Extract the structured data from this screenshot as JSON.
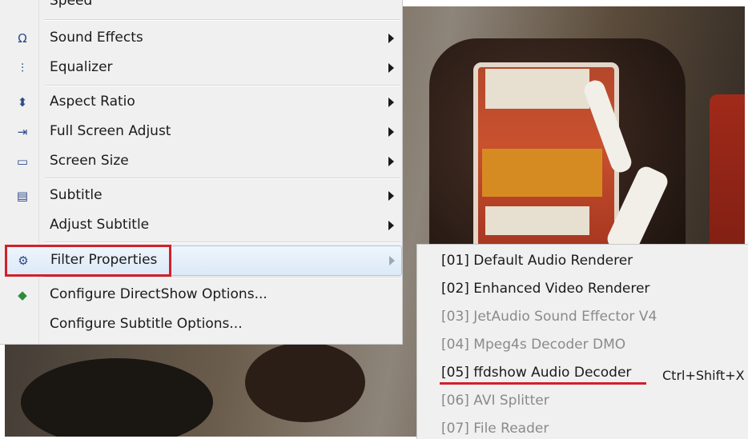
{
  "menu": {
    "partial_top": "Speed",
    "items": [
      {
        "label": "Sound Effects",
        "icon": "headphones-icon",
        "glyph": "Ω"
      },
      {
        "label": "Equalizer",
        "icon": "equalizer-icon",
        "glyph": "⫶"
      },
      {
        "label": "Aspect Ratio",
        "icon": "aspect-ratio-icon",
        "glyph": "⬍"
      },
      {
        "label": "Full Screen Adjust",
        "icon": "fullscreen-adjust-icon",
        "glyph": "⇥"
      },
      {
        "label": "Screen Size",
        "icon": "screen-size-icon",
        "glyph": "▭"
      },
      {
        "label": "Subtitle",
        "icon": "subtitle-icon",
        "glyph": "▤"
      },
      {
        "label": "Adjust Subtitle",
        "icon": "",
        "glyph": ""
      },
      {
        "label": "Filter Properties",
        "icon": "filter-properties-icon",
        "glyph": "⚙"
      },
      {
        "label": "Configure DirectShow Options...",
        "icon": "directshow-icon",
        "glyph": "◆"
      },
      {
        "label": "Configure Subtitle Options...",
        "icon": "",
        "glyph": ""
      }
    ]
  },
  "submenu": {
    "items": [
      {
        "label": "[01] Default Audio Renderer",
        "enabled": true
      },
      {
        "label": "[02] Enhanced Video Renderer",
        "enabled": true
      },
      {
        "label": "[03] JetAudio Sound Effector V4",
        "enabled": false
      },
      {
        "label": "[04] Mpeg4s Decoder DMO",
        "enabled": false
      },
      {
        "label": "[05] ffdshow Audio Decoder",
        "enabled": true
      },
      {
        "label": "[06] AVI Splitter",
        "enabled": false
      },
      {
        "label": "[07] File Reader",
        "enabled": false
      }
    ],
    "shortcut": "Ctrl+Shift+X"
  },
  "colors": {
    "highlight": "#d1202b",
    "menu_bg": "#f0f0f0"
  }
}
